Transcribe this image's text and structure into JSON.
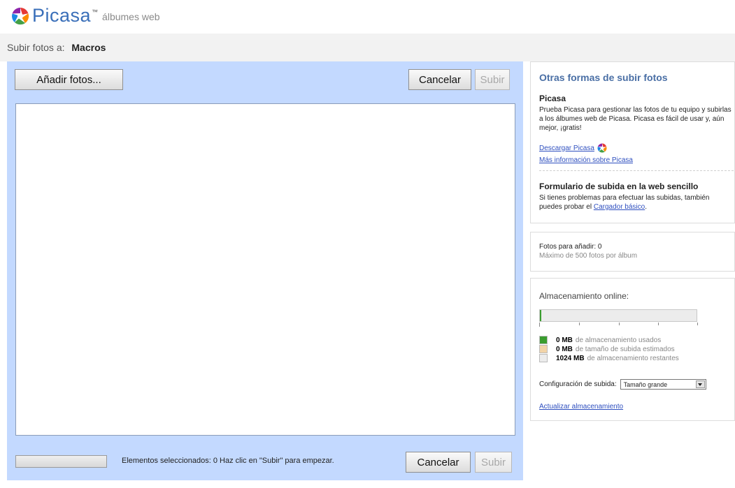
{
  "header": {
    "logo_word": "Picasa",
    "logo_tm": "™",
    "logo_sub": "álbumes web",
    "logo_icon": "picasa-pinwheel-icon"
  },
  "titlebar": {
    "label": "Subir fotos a:",
    "album": "Macros"
  },
  "upload": {
    "add_label": "Añadir fotos...",
    "cancel_label": "Cancelar",
    "upload_label": "Subir",
    "status_text": "Elementos seleccionados: 0 Haz clic en \"Subir\" para empezar."
  },
  "other": {
    "title": "Otras formas de subir fotos",
    "picasa_heading": "Picasa",
    "picasa_text": "Prueba Picasa para gestionar las fotos de tu equipo y subirlas a los álbumes web de Picasa. Picasa es fácil de usar y, aún mejor, ¡gratis!",
    "download_link": "Descargar Picasa",
    "more_link": "Más información sobre Picasa",
    "simple_heading": "Formulario de subida en la web sencillo",
    "simple_text": "Si tienes problemas para efectuar las subidas, también puedes probar el",
    "basic_link": "Cargador básico",
    "period": "."
  },
  "counts": {
    "photos_label": "Fotos para añadir: 0",
    "max_label": "Máximo de 500 fotos por álbum"
  },
  "storage": {
    "label": "Almacenamiento online:",
    "used_fraction": 0.004,
    "legend": [
      {
        "amount": "0 MB",
        "text": "de almacenamiento usados",
        "color": "#3a9d2f"
      },
      {
        "amount": "0 MB",
        "text": "de tamaño de subida estimados",
        "color": "#f2d4a8"
      },
      {
        "amount": "1024 MB",
        "text": "de almacenamiento restantes",
        "color": "#ececec"
      }
    ],
    "config_label": "Configuración de subida:",
    "config_value": "Tamaño grande",
    "upgrade_link": "Actualizar almacenamiento"
  }
}
